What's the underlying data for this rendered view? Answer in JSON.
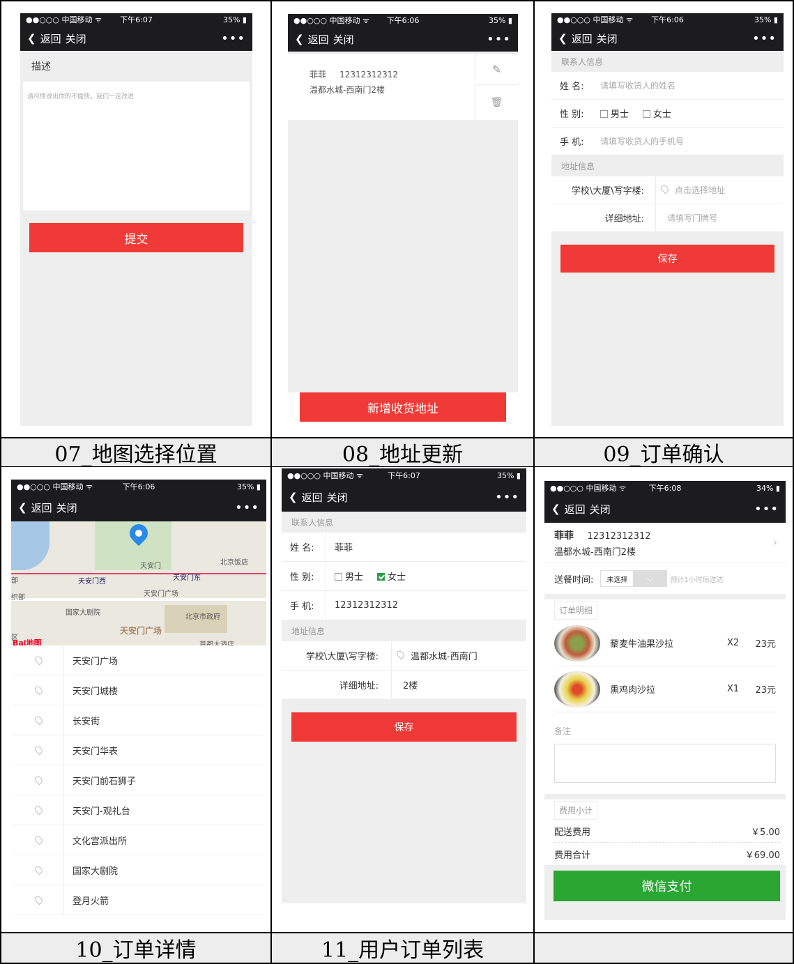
{
  "common": {
    "status_carrier": "●●○○○ 中国移动 ᯤ",
    "back_label": "返回",
    "close_label": "关闭",
    "more_label": "•••",
    "battery_35": "35%",
    "battery_34": "34%"
  },
  "captions": {
    "c07": "07_地图选择位置",
    "c08": "08_地址更新",
    "c09": "09_订单确认",
    "c10": "10_订单详情",
    "c11": "11_用户订单列表"
  },
  "s07": {
    "time": "下午6:07",
    "title": "描述",
    "placeholder": "请尽情说出你的不愉快，我们一定改进",
    "submit": "提交"
  },
  "s08": {
    "time": "下午6:06",
    "name": "菲菲",
    "phone": "12312312312",
    "address": "温都水城-西南门2楼",
    "add_button": "新增收货地址"
  },
  "s09": {
    "time": "下午6:06",
    "contact_section": "联系人信息",
    "name_label": "姓 名:",
    "name_placeholder": "请填写收货人的姓名",
    "gender_label": "性 别:",
    "male": "男士",
    "female": "女士",
    "phone_label": "手 机:",
    "phone_placeholder": "请填写收货人的手机号",
    "address_section": "地址信息",
    "school_label": "学校\\大厦\\写字楼:",
    "school_placeholder": "点击选择地址",
    "detail_label": "详细地址:",
    "detail_placeholder": "请填写门牌号",
    "save": "保存"
  },
  "s10": {
    "time": "下午6:06",
    "map_labels": [
      "天安门",
      "北京饭店",
      "天安门西",
      "天安门东",
      "天安门广场",
      "国家大剧院",
      "北京市政府",
      "天安门广场",
      "首都大酒店",
      "部",
      "织部",
      "区"
    ],
    "baidu_logo": "Bai地图",
    "places": [
      "天安门广场",
      "天安门城楼",
      "长安街",
      "天安门华表",
      "天安门前石狮子",
      "天安门-观礼台",
      "文化宫派出所",
      "国家大剧院",
      "登月火箭"
    ]
  },
  "s11": {
    "time": "下午6:07",
    "contact_section": "联系人信息",
    "name_label": "姓 名:",
    "name_value": "菲菲",
    "gender_label": "性 别:",
    "male": "男士",
    "female": "女士",
    "phone_label": "手 机:",
    "phone_value": "12312312312",
    "address_section": "地址信息",
    "school_label": "学校\\大厦\\写字楼:",
    "school_value": "温都水城-西南门",
    "detail_label": "详细地址:",
    "detail_value": "2楼",
    "save": "保存"
  },
  "s12": {
    "time": "下午6:08",
    "name": "菲菲",
    "phone": "12312312312",
    "address": "温都水城-西南门2楼",
    "delivery_label": "送餐时间:",
    "delivery_value": "未选择",
    "delivery_hint": "预计1小时后送达",
    "order_section": "订单明细",
    "items": [
      {
        "name": "藜麦牛油果沙拉",
        "qty": "X2",
        "price": "23元"
      },
      {
        "name": "熏鸡肉沙拉",
        "qty": "X1",
        "price": "23元"
      }
    ],
    "note_label": "备注",
    "fee_section": "费用小计",
    "delivery_fee_label": "配送费用",
    "delivery_fee": "￥5.00",
    "total_label": "费用合计",
    "total": "￥69.00",
    "pay_button": "微信支付"
  }
}
